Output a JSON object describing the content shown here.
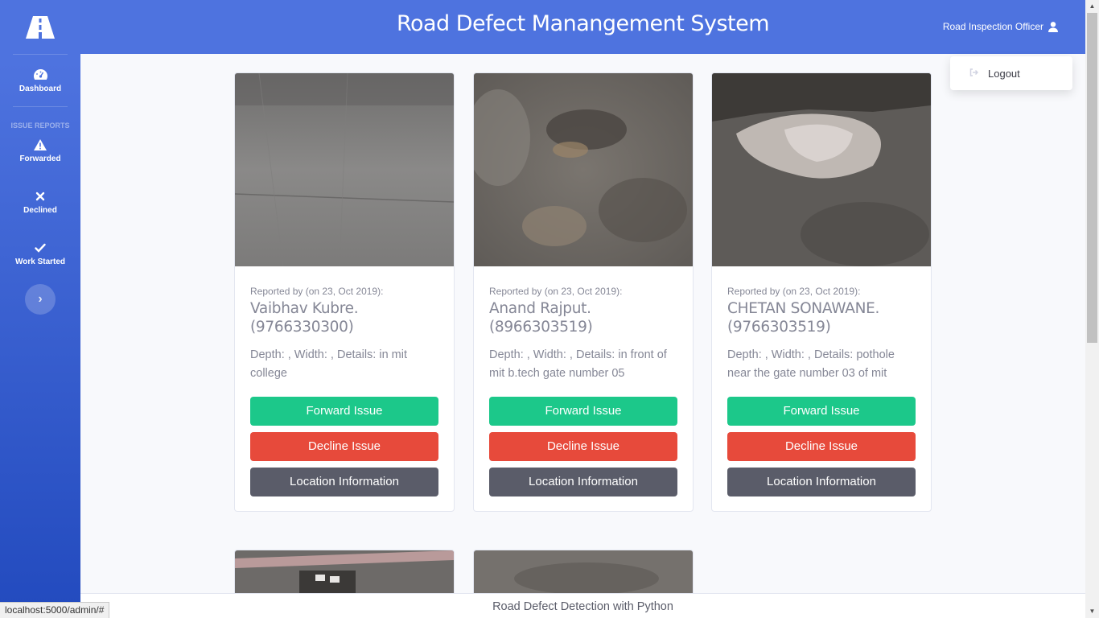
{
  "app": {
    "title": "Road Defect Manangement System"
  },
  "user": {
    "name": "Road Inspection Officer",
    "icon": "user-icon"
  },
  "dropdown": {
    "logout_label": "Logout"
  },
  "sidebar": {
    "brand_icon": "road-icon",
    "dashboard_label": "Dashboard",
    "section_heading": "ISSUE REPORTS",
    "items": [
      {
        "label": "Forwarded",
        "icon": "warning-icon"
      },
      {
        "label": "Declined",
        "icon": "times-icon"
      },
      {
        "label": "Work Started",
        "icon": "check-icon"
      }
    ]
  },
  "cards": [
    {
      "reported_by": "Reported by (on 23, Oct 2019):",
      "name": "Vaibhav Kubre.",
      "phone": "(9766330300)",
      "details": "Depth: , Width: , Details: in mit college"
    },
    {
      "reported_by": "Reported by (on 23, Oct 2019):",
      "name": "Anand Rajput.",
      "phone": "(8966303519)",
      "details": "Depth: , Width: , Details: in front of mit b.tech gate number 05"
    },
    {
      "reported_by": "Reported by (on 23, Oct 2019):",
      "name": "CHETAN SONAWANE.",
      "phone": "(9766303519)",
      "details": "Depth: , Width: , Details: pothole near the gate number 03 of mit"
    }
  ],
  "buttons": {
    "forward": "Forward Issue",
    "decline": "Decline Issue",
    "location": "Location Information"
  },
  "footer": {
    "text": "Road Defect Detection with Python"
  },
  "status_url": "localhost:5000/admin/#",
  "colors": {
    "primary": "#4e73df",
    "success": "#1cc88a",
    "danger": "#e74a3b",
    "dark": "#5a5c69"
  }
}
